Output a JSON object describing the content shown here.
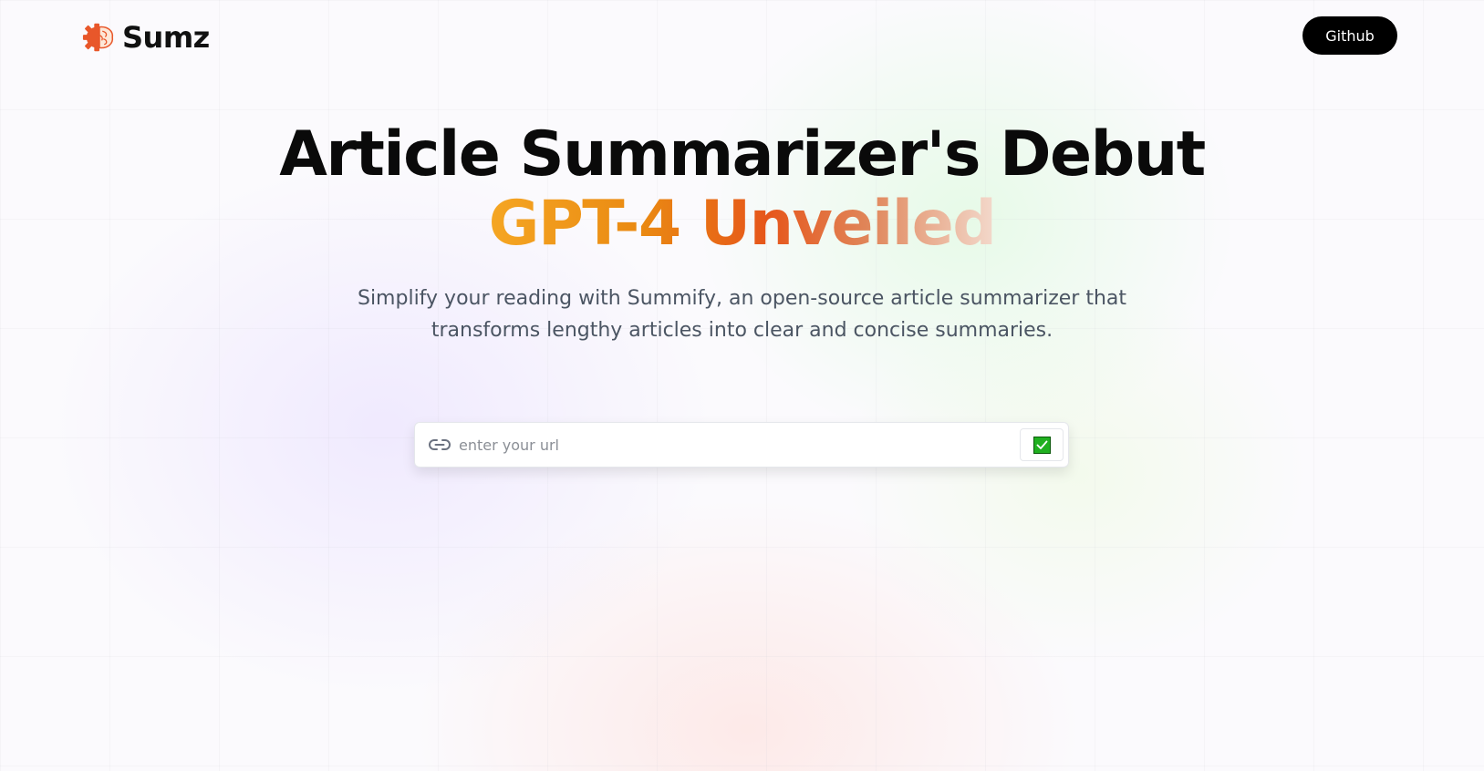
{
  "navbar": {
    "logo_text": "Sumz",
    "logo_icon": "brain-gear-icon",
    "github_label": "Github"
  },
  "hero": {
    "title_line1": "Article Summarizer's Debut",
    "title_line2": "GPT-4 Unveiled",
    "subtitle": "Simplify your reading with Summify, an open-source article summarizer that transforms lengthy articles into clear and concise summaries."
  },
  "search": {
    "placeholder": "enter your url",
    "value": "",
    "link_icon": "link-icon",
    "submit_icon": "check-mark-icon"
  },
  "colors": {
    "accent_orange": "#ea8a12",
    "accent_red_orange": "#e6561a",
    "button_dark": "#000000",
    "submit_green": "#20b020"
  }
}
